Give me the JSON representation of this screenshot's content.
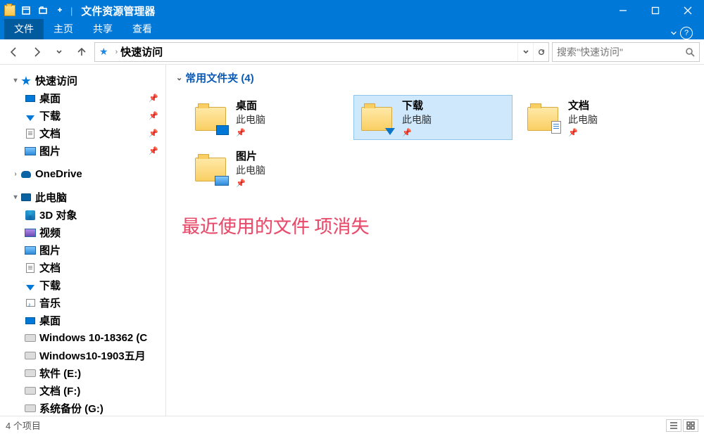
{
  "title": "文件资源管理器",
  "tabs": {
    "file": "文件",
    "home": "主页",
    "share": "共享",
    "view": "查看"
  },
  "breadcrumb": {
    "current": "快速访问"
  },
  "search": {
    "placeholder": "搜索\"快速访问\""
  },
  "sidebar": {
    "quick": {
      "label": "快速访问",
      "items": [
        {
          "label": "桌面",
          "icon": "desktop"
        },
        {
          "label": "下载",
          "icon": "download"
        },
        {
          "label": "文档",
          "icon": "document"
        },
        {
          "label": "图片",
          "icon": "picture"
        }
      ]
    },
    "onedrive": {
      "label": "OneDrive"
    },
    "thispc": {
      "label": "此电脑",
      "items": [
        {
          "label": "3D 对象",
          "icon": "3d"
        },
        {
          "label": "视频",
          "icon": "video"
        },
        {
          "label": "图片",
          "icon": "picture"
        },
        {
          "label": "文档",
          "icon": "document"
        },
        {
          "label": "下载",
          "icon": "download"
        },
        {
          "label": "音乐",
          "icon": "music"
        },
        {
          "label": "桌面",
          "icon": "desktop"
        },
        {
          "label": "Windows 10-18362 (C",
          "icon": "drive"
        },
        {
          "label": "Windows10-1903五月",
          "icon": "drive"
        },
        {
          "label": "软件 (E:)",
          "icon": "drive"
        },
        {
          "label": "文档 (F:)",
          "icon": "drive"
        },
        {
          "label": "系统备份 (G:)",
          "icon": "drive"
        }
      ]
    }
  },
  "content": {
    "group_header": "常用文件夹 (4)",
    "tiles": [
      {
        "label": "桌面",
        "sub": "此电脑",
        "overlay": "blue"
      },
      {
        "label": "下载",
        "sub": "此电脑",
        "overlay": "arrow",
        "selected": true
      },
      {
        "label": "文档",
        "sub": "此电脑",
        "overlay": "doc"
      },
      {
        "label": "图片",
        "sub": "此电脑",
        "overlay": "pic"
      }
    ]
  },
  "annotation": "最近使用的文件 项消失",
  "statusbar": {
    "count": "4 个项目"
  }
}
